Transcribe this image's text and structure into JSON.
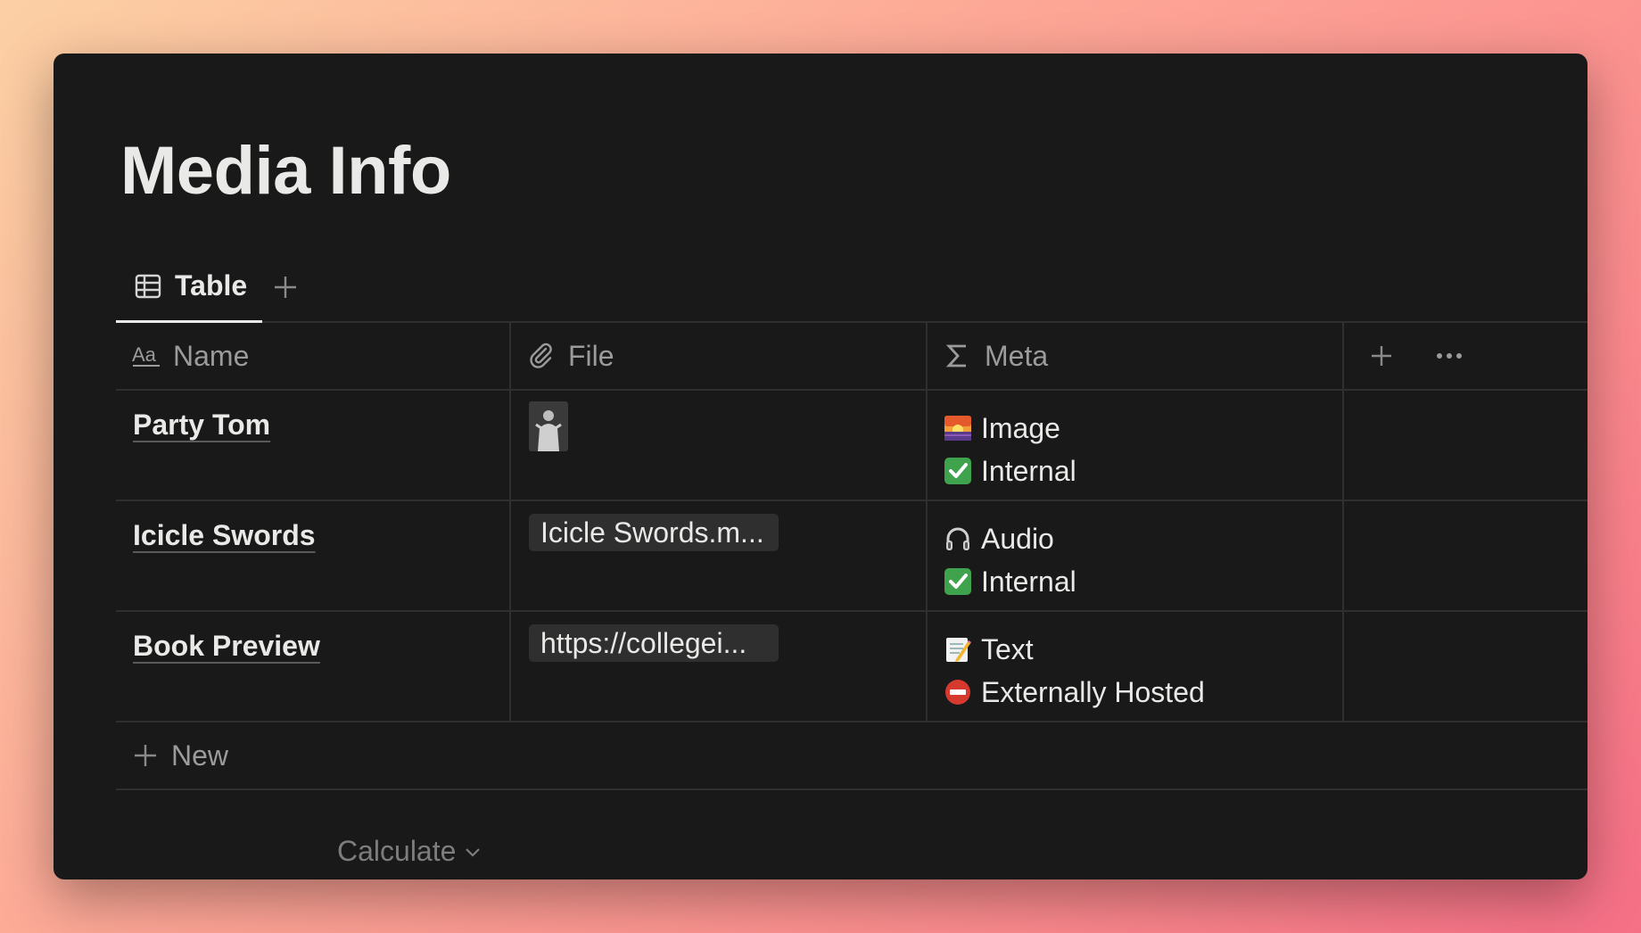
{
  "page": {
    "title": "Media Info"
  },
  "view_tabs": {
    "active_label": "Table"
  },
  "columns": [
    {
      "label": "Name",
      "icon": "text-aa-icon"
    },
    {
      "label": "File",
      "icon": "paperclip-icon"
    },
    {
      "label": "Meta",
      "icon": "sigma-icon"
    }
  ],
  "rows": [
    {
      "name": "Party Tom",
      "file": {
        "type": "thumbnail"
      },
      "meta": [
        {
          "emoji": "sunrise-image-emoji",
          "text": "Image"
        },
        {
          "emoji": "check-mark-emoji",
          "text": "Internal"
        }
      ]
    },
    {
      "name": "Icicle Swords",
      "file": {
        "type": "chip",
        "label": "Icicle Swords.m..."
      },
      "meta": [
        {
          "emoji": "headphones-emoji",
          "text": "Audio"
        },
        {
          "emoji": "check-mark-emoji",
          "text": "Internal"
        }
      ]
    },
    {
      "name": "Book Preview",
      "file": {
        "type": "chip",
        "label": "https://collegei..."
      },
      "meta": [
        {
          "emoji": "memo-emoji",
          "text": "Text"
        },
        {
          "emoji": "no-entry-emoji",
          "text": "Externally Hosted"
        }
      ]
    }
  ],
  "new_row": {
    "label": "New"
  },
  "calculate": {
    "label": "Calculate"
  },
  "colors": {
    "background": "#191919",
    "text": "#e9e9e7",
    "muted": "#9b9b9b",
    "divider": "#2f2f2f",
    "check_green": "#3fa34d",
    "no_entry_red": "#d63a2f"
  }
}
